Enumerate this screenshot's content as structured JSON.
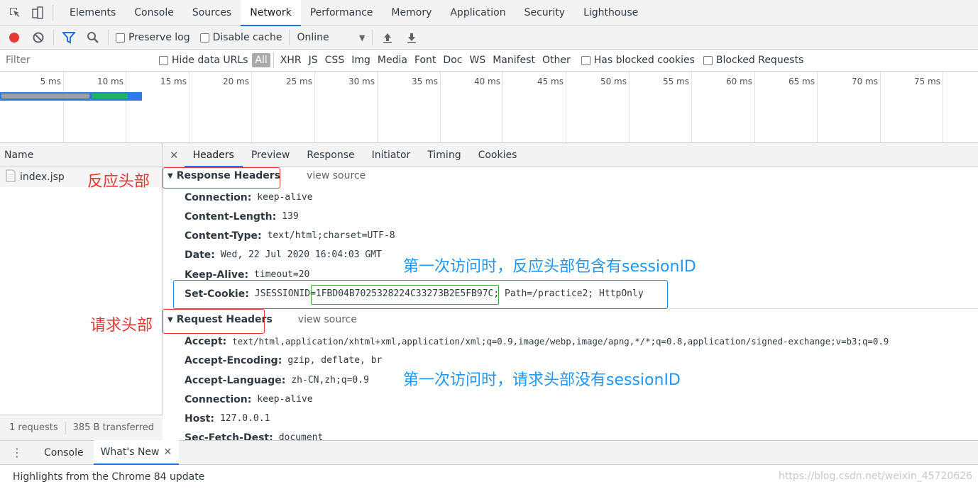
{
  "main_tabs": [
    "Elements",
    "Console",
    "Sources",
    "Network",
    "Performance",
    "Memory",
    "Application",
    "Security",
    "Lighthouse"
  ],
  "active_tab": "Network",
  "toolbar": {
    "preserve_log": "Preserve log",
    "disable_cache": "Disable cache",
    "throttle_value": "Online"
  },
  "filterbar": {
    "placeholder": "Filter",
    "hide_data_urls": "Hide data URLs",
    "types": [
      "All",
      "XHR",
      "JS",
      "CSS",
      "Img",
      "Media",
      "Font",
      "Doc",
      "WS",
      "Manifest",
      "Other"
    ],
    "has_blocked_cookies": "Has blocked cookies",
    "blocked_requests": "Blocked Requests"
  },
  "overview": {
    "ticks": [
      "5 ms",
      "10 ms",
      "15 ms",
      "20 ms",
      "25 ms",
      "30 ms",
      "35 ms",
      "40 ms",
      "45 ms",
      "50 ms",
      "55 ms",
      "60 ms",
      "65 ms",
      "70 ms",
      "75 ms"
    ]
  },
  "requests": {
    "name_header": "Name",
    "file": "index.jsp",
    "count": "1 requests",
    "transferred": "385 B transferred"
  },
  "detail_tabs": [
    "Headers",
    "Preview",
    "Response",
    "Initiator",
    "Timing",
    "Cookies"
  ],
  "response_headers": {
    "title": "Response Headers",
    "view_source": "view source",
    "items": [
      {
        "key": "Connection:",
        "value": "keep-alive"
      },
      {
        "key": "Content-Length:",
        "value": "139"
      },
      {
        "key": "Content-Type:",
        "value": "text/html;charset=UTF-8"
      },
      {
        "key": "Date:",
        "value": "Wed, 22 Jul 2020 16:04:03 GMT"
      },
      {
        "key": "Keep-Alive:",
        "value": "timeout=20"
      }
    ],
    "set_cookie": {
      "key": "Set-Cookie:",
      "prefix": "JSESSIONID=",
      "session_id": "1FBD04B7025328224C33273B2E5FB97C",
      "suffix": "; Path=/practice2; HttpOnly"
    }
  },
  "request_headers": {
    "title": "Request Headers",
    "view_source": "view source",
    "items": [
      {
        "key": "Accept:",
        "value": "text/html,application/xhtml+xml,application/xml;q=0.9,image/webp,image/apng,*/*;q=0.8,application/signed-exchange;v=b3;q=0.9"
      },
      {
        "key": "Accept-Encoding:",
        "value": "gzip, deflate, br"
      },
      {
        "key": "Accept-Language:",
        "value": "zh-CN,zh;q=0.9"
      },
      {
        "key": "Connection:",
        "value": "keep-alive"
      },
      {
        "key": "Host:",
        "value": "127.0.0.1"
      },
      {
        "key": "Sec-Fetch-Dest:",
        "value": "document"
      }
    ]
  },
  "annotations": {
    "response_label": "反应头部",
    "request_label": "请求头部",
    "response_note": "第一次访问时，反应头部包含有sessionID",
    "request_note": "第一次访问时，请求头部没有sessionID"
  },
  "drawer": {
    "tabs": [
      "Console",
      "What's New"
    ],
    "content": "Highlights from the Chrome 84 update"
  },
  "watermark": "https://blog.csdn.net/weixin_45720626"
}
